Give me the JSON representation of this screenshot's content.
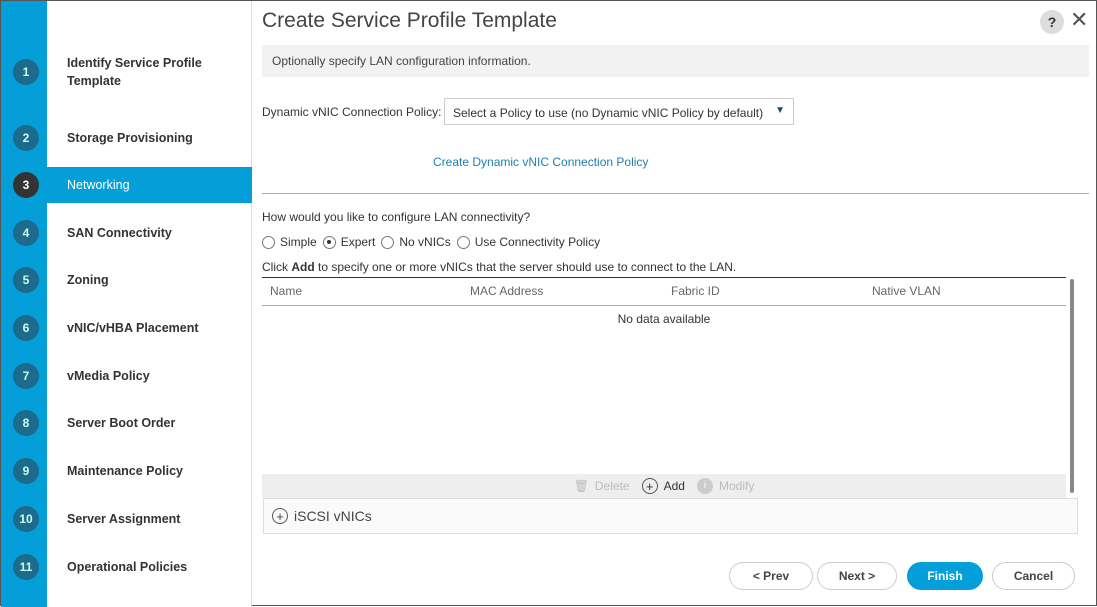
{
  "sidebar": {
    "steps": [
      {
        "num": "1",
        "label": "Identify Service Profile Template"
      },
      {
        "num": "2",
        "label": "Storage Provisioning"
      },
      {
        "num": "3",
        "label": "Networking",
        "active": true
      },
      {
        "num": "4",
        "label": "SAN Connectivity"
      },
      {
        "num": "5",
        "label": "Zoning"
      },
      {
        "num": "6",
        "label": "vNIC/vHBA Placement"
      },
      {
        "num": "7",
        "label": "vMedia Policy"
      },
      {
        "num": "8",
        "label": "Server Boot Order"
      },
      {
        "num": "9",
        "label": "Maintenance Policy"
      },
      {
        "num": "10",
        "label": "Server Assignment"
      },
      {
        "num": "11",
        "label": "Operational Policies"
      }
    ]
  },
  "header": {
    "title": "Create Service Profile Template",
    "help": "?",
    "close": "✕"
  },
  "main": {
    "info": "Optionally specify LAN configuration information.",
    "dynamic_label": "Dynamic vNIC Connection Policy:",
    "dynamic_value": "Select a Policy to use (no Dynamic vNIC Policy by default)",
    "create_link": "Create Dynamic vNIC Connection Policy",
    "question": "How would you like to configure LAN connectivity?",
    "options": [
      {
        "label": "Simple"
      },
      {
        "label": "Expert",
        "selected": true
      },
      {
        "label": "No vNICs"
      },
      {
        "label": "Use Connectivity Policy"
      }
    ],
    "click_pre": "Click ",
    "click_bold": "Add",
    "click_post": " to specify one or more vNICs that the server should use to connect to the LAN.",
    "columns": [
      "Name",
      "MAC Address",
      "Fabric ID",
      "Native VLAN"
    ],
    "no_data": "No data available",
    "toolbar": {
      "delete": "Delete",
      "add": "Add",
      "modify": "Modify"
    },
    "iscsi": "iSCSI vNICs"
  },
  "footer": {
    "prev": "< Prev",
    "next": "Next >",
    "finish": "Finish",
    "cancel": "Cancel"
  },
  "colors": {
    "accent": "#049fd9",
    "step_circle": "#1c6a8c"
  }
}
